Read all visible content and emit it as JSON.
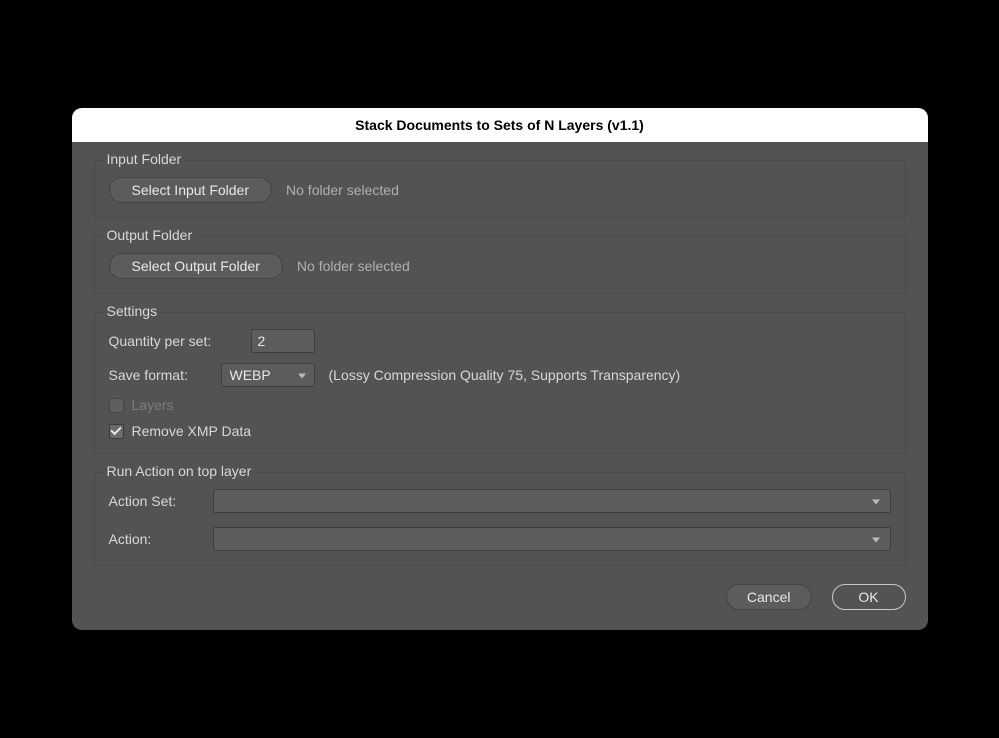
{
  "dialog": {
    "title": "Stack Documents to Sets of N Layers (v1.1)"
  },
  "input_folder": {
    "legend": "Input Folder",
    "button_label": "Select Input Folder",
    "status": "No folder selected"
  },
  "output_folder": {
    "legend": "Output Folder",
    "button_label": "Select Output Folder",
    "status": "No folder selected"
  },
  "settings": {
    "legend": "Settings",
    "quantity_label": "Quantity per set:",
    "quantity_value": "2",
    "format_label": "Save format:",
    "format_value": "WEBP",
    "format_hint": "(Lossy Compression Quality 75, Supports Transparency)",
    "layers_label": "Layers",
    "layers_checked": false,
    "layers_disabled": true,
    "remove_xmp_label": "Remove XMP Data",
    "remove_xmp_checked": true
  },
  "run_action": {
    "legend": "Run Action on top layer",
    "action_set_label": "Action Set:",
    "action_set_value": "",
    "action_label": "Action:",
    "action_value": ""
  },
  "footer": {
    "cancel_label": "Cancel",
    "ok_label": "OK"
  }
}
